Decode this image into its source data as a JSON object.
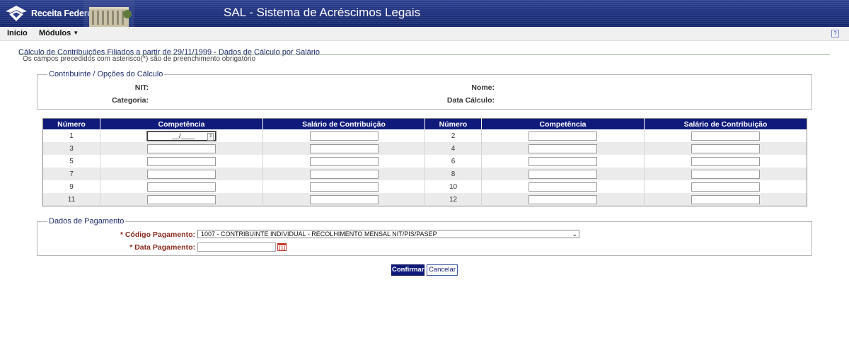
{
  "header": {
    "logo_text": "Receita Federal",
    "app_title": "SAL - Sistema de Acréscimos Legais"
  },
  "menu": {
    "items": [
      {
        "label": "Início"
      },
      {
        "label": "Módulos",
        "has_dropdown": true
      }
    ],
    "help_label": "?"
  },
  "page": {
    "title": "Cálculo de Contribuições Filiados a partir de 29/11/1999 - Dados de Cálculo por Salário",
    "subtitle": "Os campos precedidos com asterisco(*) são de preenchimento obrigatório"
  },
  "contribuinte": {
    "legend": "Contribuinte / Opções do Cálculo",
    "nit_label": "NIT:",
    "nome_label": "Nome:",
    "categoria_label": "Categoria:",
    "data_calculo_label": "Data Cálculo:"
  },
  "grid": {
    "headers": [
      "Número",
      "Competência",
      "Salário de Contribuição",
      "Número",
      "Competência",
      "Salário de Contribuição"
    ],
    "rows": [
      {
        "left": "1",
        "right": "2"
      },
      {
        "left": "3",
        "right": "4"
      },
      {
        "left": "5",
        "right": "6"
      },
      {
        "left": "7",
        "right": "8"
      },
      {
        "left": "9",
        "right": "10"
      },
      {
        "left": "11",
        "right": "12"
      }
    ],
    "first_mask": "__/____"
  },
  "pagamento": {
    "legend": "Dados de Pagamento",
    "codigo_label": "* Código Pagamento:",
    "codigo_value": "1007 - CONTRIBUINTE INDIVIDUAL - RECOLHIMENTO MENSAL NIT/PIS/PASEP",
    "data_label": "* Data Pagamento:",
    "data_value": ""
  },
  "actions": {
    "confirm": "Confirmar",
    "cancel": "Cancelar"
  },
  "colors": {
    "header_blue": "#13246c",
    "table_header": "#0f1a7a",
    "title_text": "#1d2b6b",
    "required_label": "#8b2b1f"
  }
}
